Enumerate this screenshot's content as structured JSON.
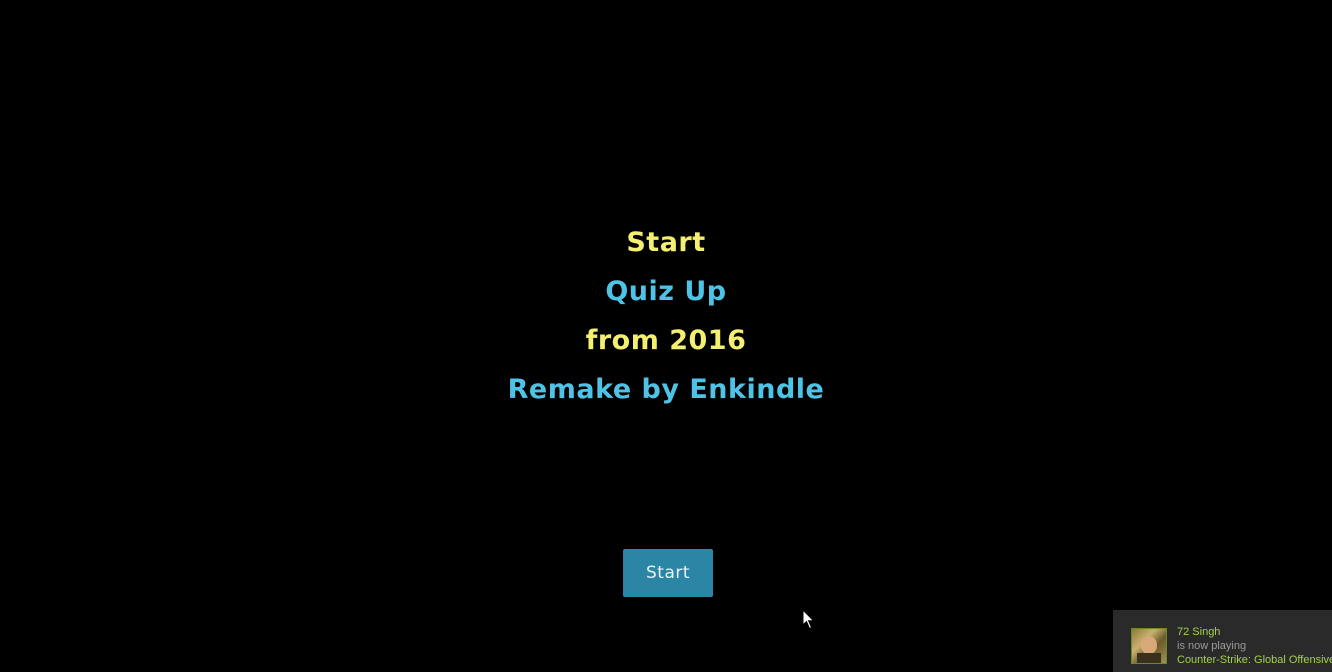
{
  "title_lines": [
    {
      "text": "Start",
      "color": "#f4ef6e"
    },
    {
      "text": "Quiz Up",
      "color": "#4ec3e6"
    },
    {
      "text": "from 2016",
      "color": "#f4ef6e"
    },
    {
      "text": "Remake by Enkindle",
      "color": "#4ec3e6"
    }
  ],
  "start_button": {
    "label": "Start",
    "color": "#2b86a6"
  },
  "notification": {
    "avatar_icon": "user-avatar-icon",
    "name": "72 Singh",
    "status": "is now playing",
    "game": "Counter-Strike: Global Offensive"
  },
  "cursor_icon": "mouse-pointer-icon"
}
